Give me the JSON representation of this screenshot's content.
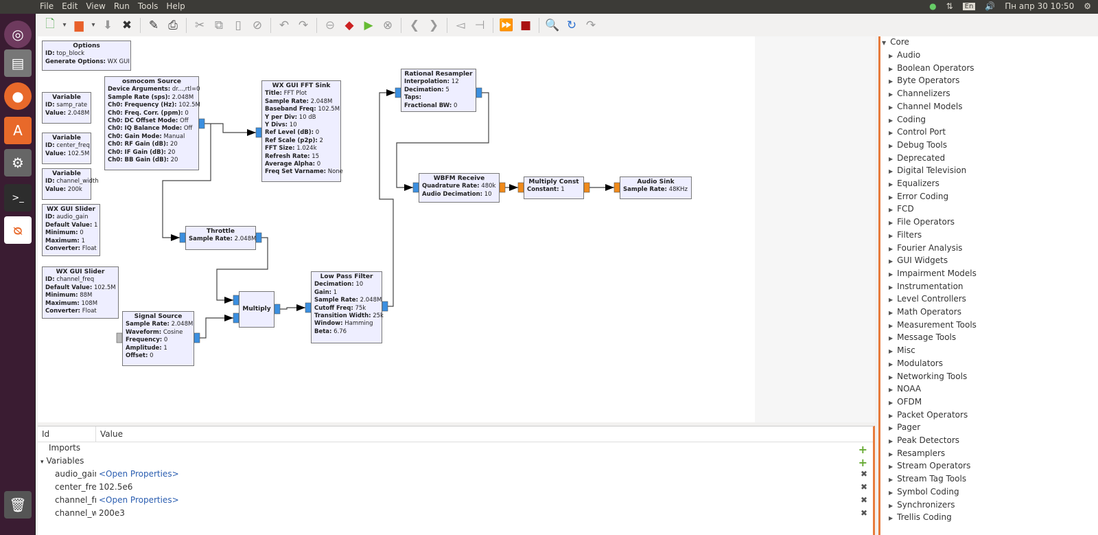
{
  "menubar": [
    "File",
    "Edit",
    "View",
    "Run",
    "Tools",
    "Help"
  ],
  "tray": {
    "lang": "En",
    "datetime": "Пн апр 30 10:50"
  },
  "toolbar_icons": [
    "new-icon",
    "dropdown-icon",
    "open-icon",
    "dropdown-icon",
    "save-icon",
    "close-icon",
    "sep",
    "edit-icon",
    "print-icon",
    "sep",
    "cut-icon",
    "copy-icon",
    "paste-icon",
    "disable-icon",
    "sep",
    "undo-icon",
    "redo-icon",
    "sep",
    "stop-icon",
    "generate-icon",
    "run-icon",
    "kill-icon",
    "sep",
    "left-icon",
    "right-icon",
    "sep",
    "bypass-icon",
    "unbypass-icon",
    "sep",
    "forward-icon",
    "record-icon",
    "sep",
    "find-icon",
    "reload-icon",
    "redo-disabled-icon"
  ],
  "blocks": [
    {
      "title": "Options",
      "params": [
        [
          "ID:",
          "top_block"
        ],
        [
          "Generate Options:",
          "WX GUI"
        ]
      ]
    },
    {
      "title": "Variable",
      "params": [
        [
          "ID:",
          "samp_rate"
        ],
        [
          "Value:",
          "2.048M"
        ]
      ]
    },
    {
      "title": "Variable",
      "params": [
        [
          "ID:",
          "center_freq"
        ],
        [
          "Value:",
          "102.5M"
        ]
      ]
    },
    {
      "title": "Variable",
      "params": [
        [
          "ID:",
          "channel_width"
        ],
        [
          "Value:",
          "200k"
        ]
      ]
    },
    {
      "title": "WX GUI Slider",
      "params": [
        [
          "ID:",
          "audio_gain"
        ],
        [
          "Default Value:",
          "1"
        ],
        [
          "Minimum:",
          "0"
        ],
        [
          "Maximum:",
          "1"
        ],
        [
          "Converter:",
          "Float"
        ]
      ]
    },
    {
      "title": "WX GUI Slider",
      "params": [
        [
          "ID:",
          "channel_freq"
        ],
        [
          "Default Value:",
          "102.5M"
        ],
        [
          "Minimum:",
          "88M"
        ],
        [
          "Maximum:",
          "108M"
        ],
        [
          "Converter:",
          "Float"
        ]
      ]
    },
    {
      "title": "osmocom Source",
      "params": [
        [
          "Device Arguments:",
          "dr...,rtl=0"
        ],
        [
          "Sample Rate (sps):",
          "2.048M"
        ],
        [
          "Ch0: Frequency (Hz):",
          "102.5M"
        ],
        [
          "Ch0: Freq. Corr. (ppm):",
          "0"
        ],
        [
          "Ch0: DC Offset Mode:",
          "Off"
        ],
        [
          "Ch0: IQ Balance Mode:",
          "Off"
        ],
        [
          "Ch0: Gain Mode:",
          "Manual"
        ],
        [
          "Ch0: RF Gain (dB):",
          "20"
        ],
        [
          "Ch0: IF Gain (dB):",
          "20"
        ],
        [
          "Ch0: BB Gain (dB):",
          "20"
        ]
      ]
    },
    {
      "title": "WX GUI FFT Sink",
      "params": [
        [
          "Title:",
          "FFT Plot"
        ],
        [
          "Sample Rate:",
          "2.048M"
        ],
        [
          "Baseband Freq:",
          "102.5M"
        ],
        [
          "Y per Div:",
          "10 dB"
        ],
        [
          "Y Divs:",
          "10"
        ],
        [
          "Ref Level (dB):",
          "0"
        ],
        [
          "Ref Scale (p2p):",
          "2"
        ],
        [
          "FFT Size:",
          "1.024k"
        ],
        [
          "Refresh Rate:",
          "15"
        ],
        [
          "Average Alpha:",
          "0"
        ],
        [
          "Freq Set Varname:",
          "None"
        ]
      ]
    },
    {
      "title": "Throttle",
      "params": [
        [
          "Sample Rate:",
          "2.048M"
        ]
      ]
    },
    {
      "title": "Signal Source",
      "params": [
        [
          "Sample Rate:",
          "2.048M"
        ],
        [
          "Waveform:",
          "Cosine"
        ],
        [
          "Frequency:",
          "0"
        ],
        [
          "Amplitude:",
          "1"
        ],
        [
          "Offset:",
          "0"
        ]
      ]
    },
    {
      "title": "Multiply",
      "params": []
    },
    {
      "title": "Low Pass Filter",
      "params": [
        [
          "Decimation:",
          "10"
        ],
        [
          "Gain:",
          "1"
        ],
        [
          "Sample Rate:",
          "2.048M"
        ],
        [
          "Cutoff Freq:",
          "75k"
        ],
        [
          "Transition Width:",
          "25k"
        ],
        [
          "Window:",
          "Hamming"
        ],
        [
          "Beta:",
          "6.76"
        ]
      ]
    },
    {
      "title": "Rational Resampler",
      "params": [
        [
          "Interpolation:",
          "12"
        ],
        [
          "Decimation:",
          "5"
        ],
        [
          "Taps:",
          ""
        ],
        [
          "Fractional BW:",
          "0"
        ]
      ]
    },
    {
      "title": "WBFM Receive",
      "params": [
        [
          "Quadrature Rate:",
          "480k"
        ],
        [
          "Audio Decimation:",
          "10"
        ]
      ]
    },
    {
      "title": "Multiply Const",
      "params": [
        [
          "Constant:",
          "1"
        ]
      ]
    },
    {
      "title": "Audio Sink",
      "params": [
        [
          "Sample Rate:",
          "48KHz"
        ]
      ]
    }
  ],
  "variables_panel": {
    "headers": [
      "Id",
      "Value"
    ],
    "rows": [
      {
        "id": "Imports",
        "value": "",
        "action": "+",
        "indent": 1
      },
      {
        "id": "Variables",
        "value": "",
        "action": "+",
        "indent": 0,
        "expander": "▾"
      },
      {
        "id": "audio_gain",
        "value": "<Open Properties>",
        "action": "✖",
        "indent": 2,
        "link": true
      },
      {
        "id": "center_freq",
        "value": "102.5e6",
        "action": "✖",
        "indent": 2
      },
      {
        "id": "channel_freq",
        "value": "<Open Properties>",
        "action": "✖",
        "indent": 2,
        "link": true
      },
      {
        "id": "channel_width",
        "value": "200e3",
        "action": "✖",
        "indent": 2
      }
    ]
  },
  "block_tree": {
    "root": "Core",
    "categories": [
      "Audio",
      "Boolean Operators",
      "Byte Operators",
      "Channelizers",
      "Channel Models",
      "Coding",
      "Control Port",
      "Debug Tools",
      "Deprecated",
      "Digital Television",
      "Equalizers",
      "Error Coding",
      "FCD",
      "File Operators",
      "Filters",
      "Fourier Analysis",
      "GUI Widgets",
      "Impairment Models",
      "Instrumentation",
      "Level Controllers",
      "Math Operators",
      "Measurement Tools",
      "Message Tools",
      "Misc",
      "Modulators",
      "Networking Tools",
      "NOAA",
      "OFDM",
      "Packet Operators",
      "Pager",
      "Peak Detectors",
      "Resamplers",
      "Stream Operators",
      "Stream Tag Tools",
      "Symbol Coding",
      "Synchronizers",
      "Trellis Coding"
    ]
  },
  "colors": {
    "complex_port": "#3b8fe0",
    "float_port": "#f08a1a",
    "block_bg": "#eeeeff",
    "accent": "#e77b3c"
  }
}
